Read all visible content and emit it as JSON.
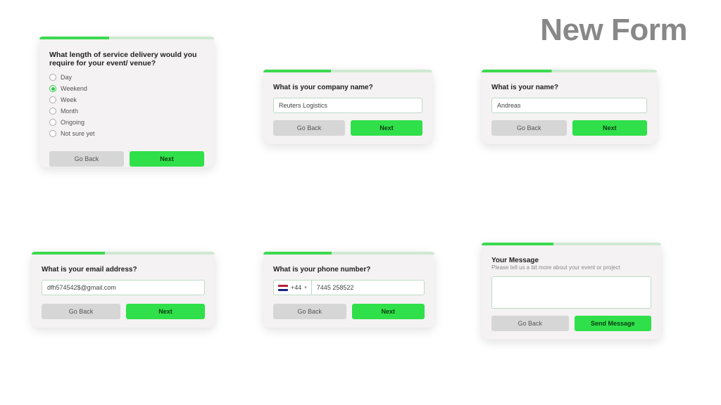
{
  "page_title": "New Form",
  "buttons": {
    "back": "Go Back",
    "next": "Next",
    "send": "Send Message"
  },
  "card1": {
    "prompt": "What length of service delivery would you require for your event/ venue?",
    "options": [
      "Day",
      "Weekend",
      "Week",
      "Month",
      "Ongoing",
      "Not sure yet"
    ],
    "selected_index": 1
  },
  "card2": {
    "prompt": "What is your company name?",
    "value": "Reuters Logistics"
  },
  "card3": {
    "prompt": "What is your name?",
    "value": "Andreas"
  },
  "card4": {
    "prompt": "What is your email address?",
    "value": "dfh574542$@gmail.com"
  },
  "card5": {
    "prompt": "What is your phone number?",
    "dial_code": "+44",
    "value": "7445 258522"
  },
  "card6": {
    "prompt": "Your Message",
    "subtext": "Please tell us a bit more about your event or project",
    "value": ""
  }
}
